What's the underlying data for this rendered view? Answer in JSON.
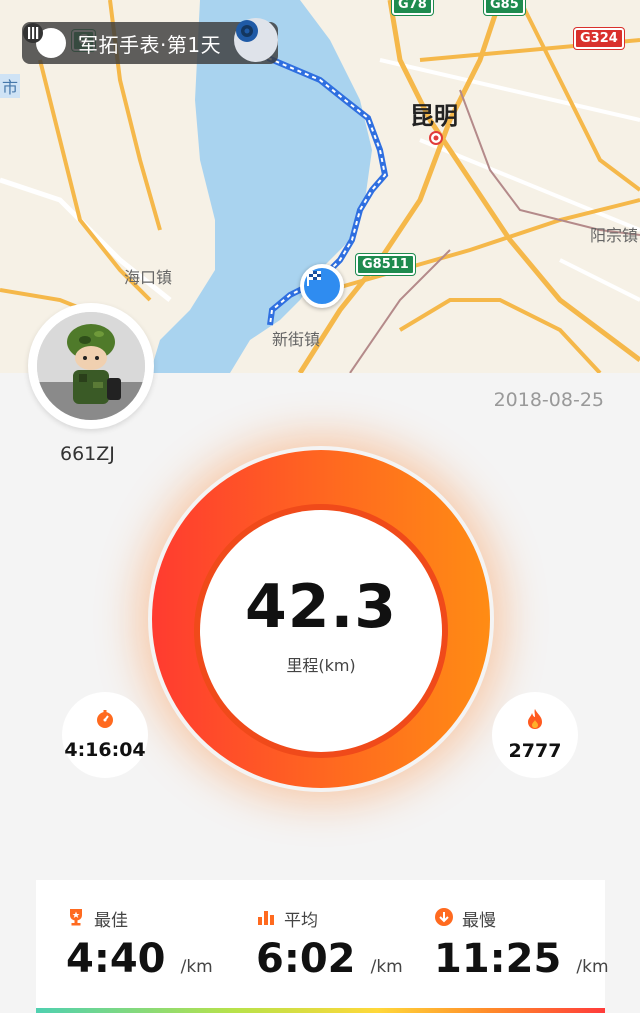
{
  "map": {
    "title": "军拓手表·第1天",
    "labels": {
      "city": "昆明",
      "haikou": "海口镇",
      "xinjie": "新街镇",
      "yangzong": "阳宗镇",
      "shi": "市"
    },
    "shields": {
      "g78": "G78",
      "g85": "G85",
      "g324": "G324",
      "g8511": "G8511",
      "g_top": "G"
    },
    "icons": {
      "logo": "watch-brand-icon",
      "locate": "locate-target-icon",
      "finish": "finish-flag-icon"
    }
  },
  "profile": {
    "username": "661ZJ",
    "date": "2018-08-25"
  },
  "summary": {
    "distance": "42.3",
    "distance_unit": "里程(km)",
    "duration": "4:16:04",
    "calories": "2777"
  },
  "pace": {
    "best": {
      "label": "最佳",
      "value": "4:40",
      "unit": "/km"
    },
    "avg": {
      "label": "平均",
      "value": "6:02",
      "unit": "/km"
    },
    "slow": {
      "label": "最慢",
      "value": "11:25",
      "unit": "/km"
    }
  },
  "colors": {
    "accent_orange": "#ff6a1f",
    "accent_red": "#ff3b30",
    "route_blue": "#2f8cf0",
    "highway_green": "#1e8b4f"
  }
}
